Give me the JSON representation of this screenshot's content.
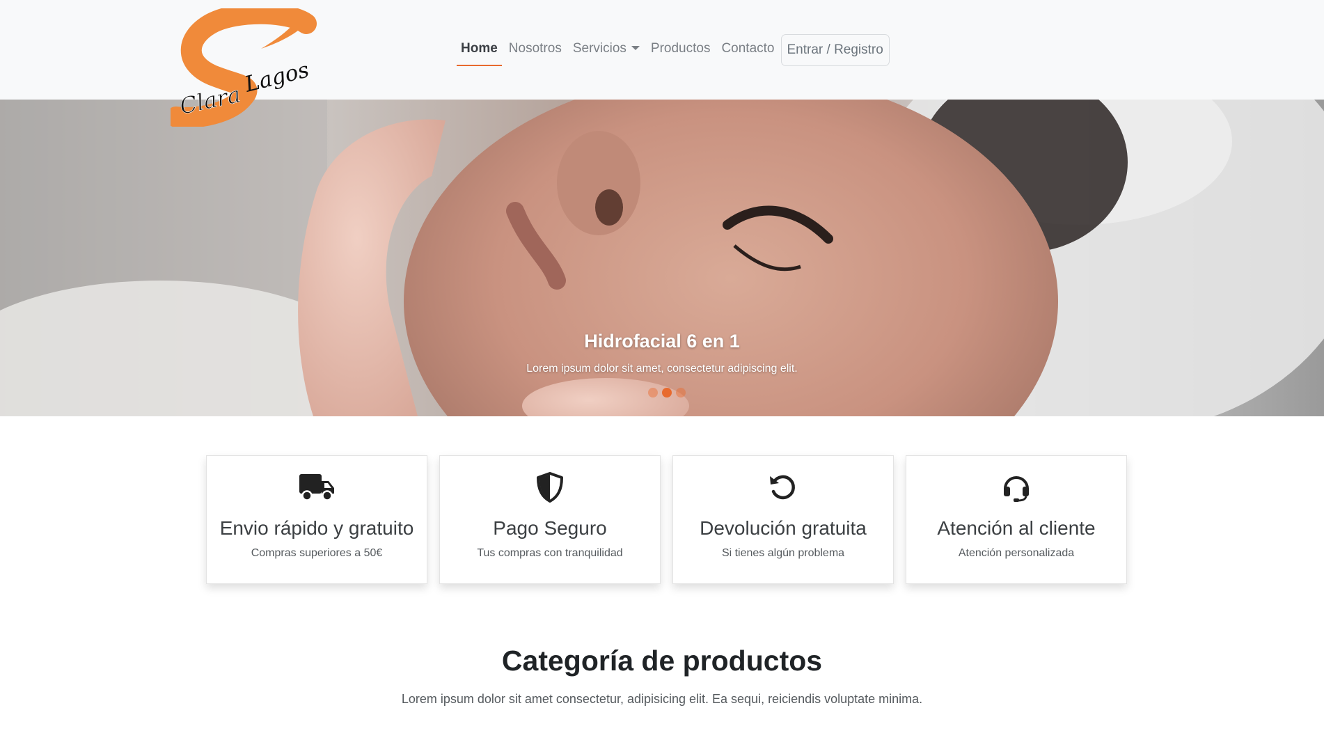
{
  "brand": {
    "name_first": "Clara",
    "name_last": "Lagos",
    "accent": "#e86a2e"
  },
  "nav": {
    "items": [
      {
        "label": "Home",
        "active": true
      },
      {
        "label": "Nosotros",
        "active": false
      },
      {
        "label": "Servicios",
        "active": false,
        "dropdown": true
      },
      {
        "label": "Productos",
        "active": false
      },
      {
        "label": "Contacto",
        "active": false
      }
    ],
    "login_label": "Entrar / Registro"
  },
  "hero": {
    "title": "Hidrofacial 6 en 1",
    "subtitle": "Lorem ipsum dolor sit amet, consectetur adipiscing elit.",
    "slides_count": 3,
    "active_slide": 2
  },
  "features": [
    {
      "icon": "truck-icon",
      "title": "Envio rápido y gratuito",
      "subtitle": "Compras superiores a 50€"
    },
    {
      "icon": "shield-icon",
      "title": "Pago Seguro",
      "subtitle": "Tus compras con tranquilidad"
    },
    {
      "icon": "rotate-left-icon",
      "title": "Devolución gratuita",
      "subtitle": "Si tienes algún problema"
    },
    {
      "icon": "headset-icon",
      "title": "Atención al cliente",
      "subtitle": "Atención personalizada"
    }
  ],
  "categories": {
    "title": "Categoría de productos",
    "subtitle": "Lorem ipsum dolor sit amet consectetur, adipisicing elit. Ea sequi, reiciendis voluptate minima."
  }
}
